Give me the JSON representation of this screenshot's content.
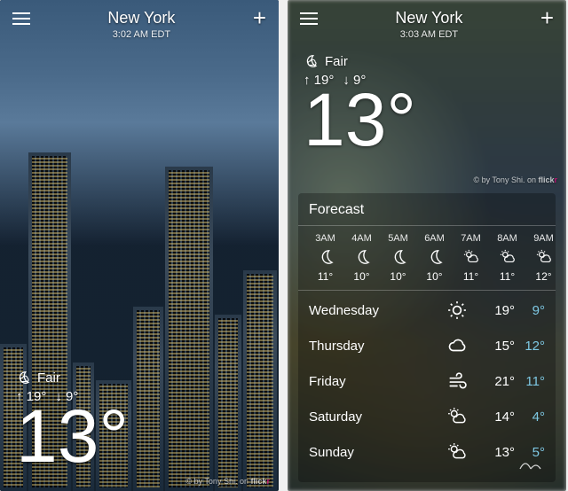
{
  "left": {
    "location": "New York",
    "time": "3:02 AM EDT",
    "condition": "Fair",
    "high": "19°",
    "low": "9°",
    "temp": "13°",
    "credit_prefix": "© by Tony Shi. on ",
    "credit_brand": "flickr"
  },
  "right": {
    "location": "New York",
    "time": "3:03 AM EDT",
    "condition": "Fair",
    "high": "19°",
    "low": "9°",
    "temp": "13°",
    "credit_prefix": "© by Tony Shi. on ",
    "credit_brand": "flickr",
    "forecast_title": "Forecast",
    "hourly": [
      {
        "label": "3AM",
        "icon": "moon",
        "temp": "11°"
      },
      {
        "label": "4AM",
        "icon": "moon",
        "temp": "10°"
      },
      {
        "label": "5AM",
        "icon": "moon",
        "temp": "10°"
      },
      {
        "label": "6AM",
        "icon": "moon",
        "temp": "10°"
      },
      {
        "label": "7AM",
        "icon": "partly",
        "temp": "11°"
      },
      {
        "label": "8AM",
        "icon": "partly",
        "temp": "11°"
      },
      {
        "label": "9AM",
        "icon": "partly",
        "temp": "12°"
      }
    ],
    "daily": [
      {
        "day": "Wednesday",
        "icon": "sun",
        "hi": "19°",
        "lo": "9°"
      },
      {
        "day": "Thursday",
        "icon": "cloud",
        "hi": "15°",
        "lo": "12°"
      },
      {
        "day": "Friday",
        "icon": "wind",
        "hi": "21°",
        "lo": "11°"
      },
      {
        "day": "Saturday",
        "icon": "partly",
        "hi": "14°",
        "lo": "4°"
      },
      {
        "day": "Sunday",
        "icon": "partly",
        "hi": "13°",
        "lo": "5°"
      }
    ]
  }
}
